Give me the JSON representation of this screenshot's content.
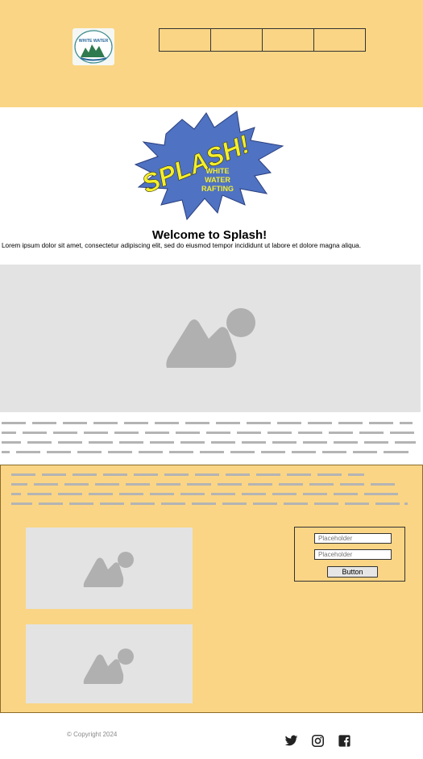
{
  "header": {
    "logo_text": "WHITE WATER",
    "nav": [
      "",
      "",
      "",
      ""
    ]
  },
  "splash": {
    "logo_word": "SPLASH!",
    "logo_sub": [
      "WHITE",
      "WATER",
      "RAFTING"
    ]
  },
  "welcome": {
    "title": "Welcome to Splash!",
    "text": "Lorem ipsum dolor sit amet, consectetur adipiscing elit, sed do eiusmod tempor incididunt ut labore et dolore magna aliqua."
  },
  "form": {
    "input1_placeholder": "Placeholder",
    "input2_placeholder": "Placeholder",
    "button_label": "Button"
  },
  "footer": {
    "copyright": "© Copyright 2024",
    "social_icons": [
      "twitter-icon",
      "instagram-icon",
      "facebook-icon"
    ]
  },
  "colors": {
    "accent": "#fad585",
    "placeholder_bg": "#e3e3e3",
    "splash_blue": "#4f72c2",
    "splash_yellow": "#f5ef2b"
  }
}
